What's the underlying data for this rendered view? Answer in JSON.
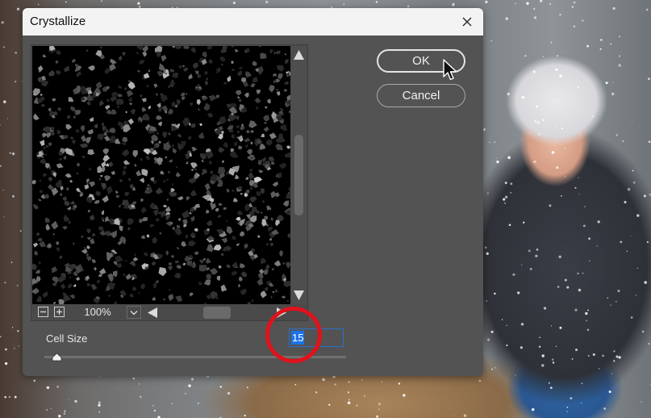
{
  "dialog": {
    "title": "Crystallize",
    "close_icon": "close-icon",
    "ok_label": "OK",
    "cancel_label": "Cancel"
  },
  "preview": {
    "zoom_out_icon": "minus-icon",
    "zoom_in_icon": "plus-icon",
    "zoom_level": "100%",
    "dropdown_icon": "chevron-down-icon",
    "scroll_up_icon": "triangle-up-icon",
    "scroll_down_icon": "triangle-down-icon",
    "scroll_left_icon": "triangle-left-icon",
    "scroll_right_icon": "triangle-right-icon"
  },
  "cell_size": {
    "label": "Cell Size",
    "value": "15",
    "slider_icon": "slider-thumb-icon"
  },
  "annotation": {
    "color": "#e0121b"
  },
  "cursor_icon": "arrow-cursor-icon",
  "colors": {
    "dialog_bg": "#535353",
    "titlebar_bg": "#f3f3f3",
    "selection": "#1a73e8",
    "focus_border": "#2d6ec9"
  }
}
